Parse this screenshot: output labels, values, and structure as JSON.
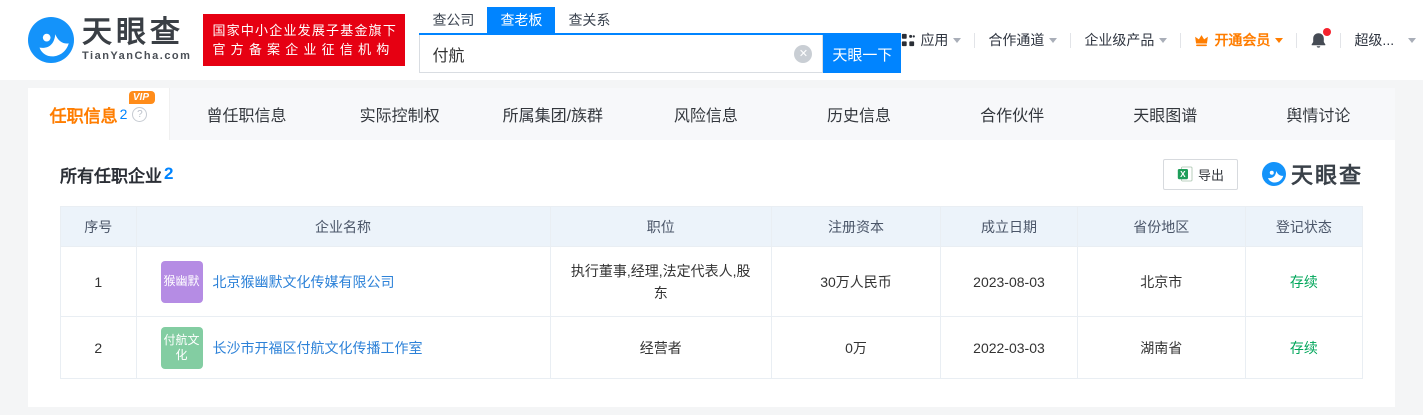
{
  "brand": {
    "logo_title": "天眼查",
    "logo_subtitle": "TianYanCha.com",
    "badge_line1": "国家中小企业发展子基金旗下",
    "badge_line2": "官方备案企业征信机构",
    "watermark": "天眼查"
  },
  "search": {
    "tabs": [
      {
        "label": "查公司",
        "active": false
      },
      {
        "label": "查老板",
        "active": true
      },
      {
        "label": "查关系",
        "active": false
      }
    ],
    "value": "付航",
    "button": "天眼一下",
    "clear_glyph": "✕"
  },
  "top_menu": {
    "apps": "应用",
    "partner": "合作通道",
    "enterprise": "企业级产品",
    "vip": "开通会员",
    "user": "超级..."
  },
  "nav_tabs": {
    "active": {
      "label": "任职信息",
      "count": "2",
      "vip": "VIP",
      "help": "?"
    },
    "items": [
      "曾任职信息",
      "实际控制权",
      "所属集团/族群",
      "风险信息",
      "历史信息",
      "合作伙伴",
      "天眼图谱",
      "舆情讨论"
    ]
  },
  "content": {
    "title": "所有任职企业",
    "count": "2",
    "export_label": "导出",
    "table": {
      "headers": [
        "序号",
        "企业名称",
        "职位",
        "注册资本",
        "成立日期",
        "省份地区",
        "登记状态"
      ],
      "rows": [
        {
          "no": "1",
          "badge": "猴幽默",
          "badge_color": "#b58ce4",
          "company": "北京猴幽默文化传媒有限公司",
          "position": "执行董事,经理,法定代表人,股东",
          "capital": "30万人民币",
          "date": "2023-08-03",
          "province": "北京市",
          "status": "存续"
        },
        {
          "no": "2",
          "badge": "付航文化",
          "badge_color": "#83cda2",
          "company": "长沙市开福区付航文化传播工作室",
          "position": "经营者",
          "capital": "0万",
          "date": "2022-03-03",
          "province": "湖南省",
          "status": "存续"
        }
      ]
    }
  },
  "colors": {
    "accent_blue": "#0084ff",
    "brand_red": "#e60012",
    "vip_orange": "#ff7d00",
    "status_green": "#00a65a",
    "link_blue": "#2d82d8",
    "table_header_bg": "#ecf3fa",
    "page_bg": "#f4f5f6"
  }
}
